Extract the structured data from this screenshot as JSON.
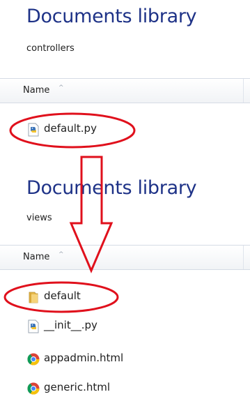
{
  "panels": [
    {
      "title": "Documents library",
      "subtitle": "controllers",
      "column_header": "Name",
      "sort_indicator": "^",
      "files": [
        {
          "name": "default.py",
          "icon": "python-file-icon"
        }
      ]
    },
    {
      "title": "Documents library",
      "subtitle": "views",
      "column_header": "Name",
      "sort_indicator": "^",
      "files": [
        {
          "name": "default",
          "icon": "folder-icon"
        },
        {
          "name": "__init__.py",
          "icon": "python-file-icon"
        },
        {
          "name": "appadmin.html",
          "icon": "chrome-html-icon"
        },
        {
          "name": "generic.html",
          "icon": "chrome-html-icon"
        }
      ]
    }
  ],
  "annotations": {
    "highlight_color": "#e0101c",
    "arrow_color": "#e0101c",
    "circled_items": [
      "default.py",
      "default"
    ]
  },
  "colors": {
    "title": "#1e3287",
    "header_border": "#d5dbe5"
  }
}
